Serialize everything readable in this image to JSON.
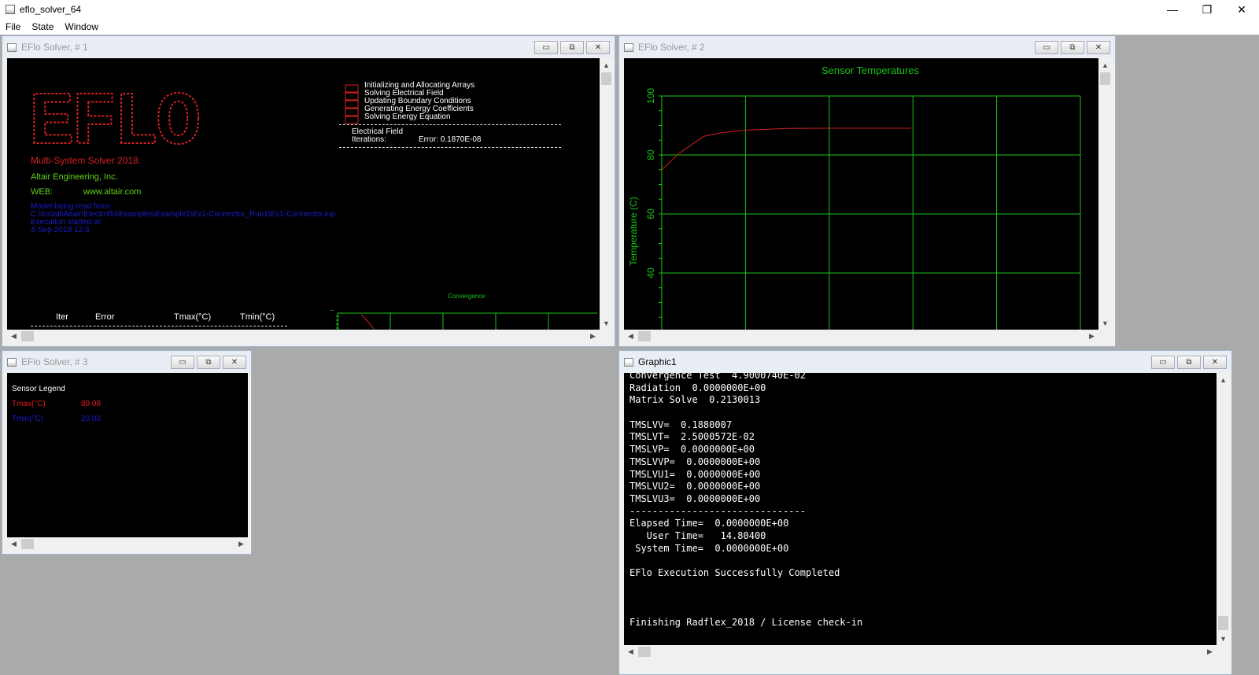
{
  "app": {
    "title": "eflo_solver_64",
    "controls": [
      "—",
      "❐",
      "✕"
    ]
  },
  "menu": [
    "File",
    "State",
    "Window"
  ],
  "win1": {
    "title": "EFlo Solver, # 1",
    "logo_text": "EFLO",
    "product": "Multi-System Solver 2018.",
    "company": "Altair Engineering, Inc.",
    "web_label": "WEB:",
    "web_url": "www.altair.com",
    "model_label": "Model being read from:",
    "model_path": "C:\\Install\\Altair\\Electroflo\\Examples\\Example1\\Ex1-Connector_Run1\\Ex1-Connector.inp",
    "exec_label": "Execution started at:",
    "exec_time": "4-Sep-2018 12:3",
    "steps": [
      "Initializing and Allocating Arrays",
      "Solving Electrical Field",
      "Updating Boundary Conditions",
      "Generating Energy Coefficients",
      "Solving Energy Equation"
    ],
    "field_label": "Electrical Field",
    "iter_label": "Iterations:",
    "error_value": "Error: 0.1870E-08",
    "convergence_label": "Convergence",
    "table_headers": [
      "Iter",
      "Error",
      "Tmax(°C)",
      "Tmin(°C)"
    ]
  },
  "win2": {
    "title": "EFlo Solver, # 2",
    "colors": {
      "grid": "#19c319",
      "line": "#d12020"
    }
  },
  "win3": {
    "title": "EFlo Solver, # 3",
    "legend_title": "Sensor Legend",
    "rows": [
      {
        "label": "Tmax(°C)",
        "value": "89.08",
        "color": "#e01a1a"
      },
      {
        "label": "Tmin(°C)",
        "value": "20.00",
        "color": "#1a1ad8"
      }
    ]
  },
  "win4": {
    "title": "Graphic1",
    "lines": [
      "Convergence Test  4.9000740E-02",
      "Radiation  0.0000000E+00",
      "Matrix Solve  0.2130013",
      "",
      "TMSLVV=  0.1880007",
      "TMSLVT=  2.5000572E-02",
      "TMSLVP=  0.0000000E+00",
      "TMSLVVP=  0.0000000E+00",
      "TMSLVU1=  0.0000000E+00",
      "TMSLVU2=  0.0000000E+00",
      "TMSLVU3=  0.0000000E+00",
      "-------------------------------",
      "Elapsed Time=  0.0000000E+00",
      "   User Time=   14.80400",
      " System Time=  0.0000000E+00",
      "",
      "EFlo Execution Successfully Completed",
      "",
      "",
      "",
      "Finishing Radflex_2018 / License check-in"
    ]
  },
  "chart_data": {
    "type": "line",
    "title": "Sensor Temperatures",
    "xlabel": "",
    "ylabel": "Temperature (C)",
    "ylim": [
      20,
      100
    ],
    "y_ticks": [
      40,
      60,
      80,
      100
    ],
    "x": [
      0,
      0.2,
      0.5,
      0.7,
      1.0,
      1.5,
      2.0,
      2.98
    ],
    "series": [
      {
        "values": [
          75.0,
          80.4,
          86.3,
          87.5,
          88.4,
          89.0,
          89.08,
          89.08
        ]
      }
    ],
    "grid": true
  }
}
